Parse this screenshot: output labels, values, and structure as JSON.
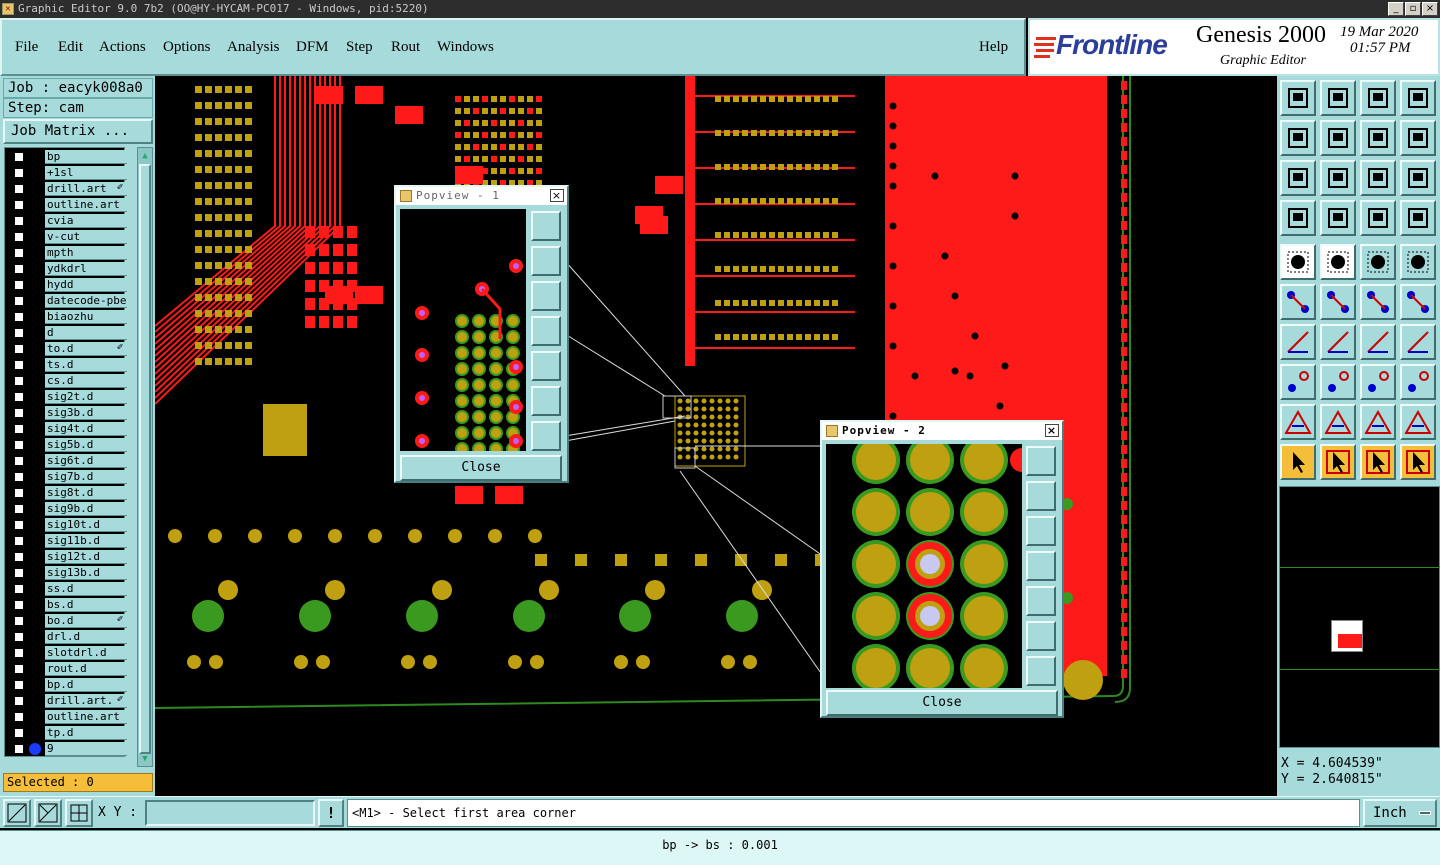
{
  "window": {
    "title": "Graphic Editor 9.0 7b2 (OO@HY-HYCAM-PC017 - Windows, pid:5220)",
    "minimize": "_",
    "maximize": "▫",
    "close": "×"
  },
  "menu": {
    "items": [
      "File",
      "Edit",
      "Actions",
      "Options",
      "Analysis",
      "DFM",
      "Step",
      "Rout",
      "Windows"
    ],
    "help": "Help"
  },
  "brand": {
    "logo": "Frontline",
    "product": "Genesis 2000",
    "subtitle": "Graphic Editor",
    "date": "19 Mar 2020",
    "time": "01:57 PM"
  },
  "left_panel": {
    "job": "Job : eacyk008a0",
    "step": "Step: cam",
    "job_matrix_button": "Job Matrix ...",
    "layers": [
      {
        "name": "bp",
        "mark": ""
      },
      {
        "name": "+1sl",
        "mark": ""
      },
      {
        "name": "drill.art",
        "mark": "✐"
      },
      {
        "name": "outline.art",
        "mark": ""
      },
      {
        "name": "cvia",
        "mark": ""
      },
      {
        "name": "v-cut",
        "mark": ""
      },
      {
        "name": "mpth",
        "mark": ""
      },
      {
        "name": "ydkdrl",
        "mark": ""
      },
      {
        "name": "hydd",
        "mark": ""
      },
      {
        "name": "datecode-pbe",
        "mark": ""
      },
      {
        "name": "biaozhu",
        "mark": ""
      },
      {
        "name": "d",
        "mark": ""
      },
      {
        "name": "to.d",
        "mark": "✐"
      },
      {
        "name": "ts.d",
        "mark": ""
      },
      {
        "name": "cs.d",
        "mark": ""
      },
      {
        "name": "sig2t.d",
        "mark": ""
      },
      {
        "name": "sig3b.d",
        "mark": ""
      },
      {
        "name": "sig4t.d",
        "mark": ""
      },
      {
        "name": "sig5b.d",
        "mark": ""
      },
      {
        "name": "sig6t.d",
        "mark": ""
      },
      {
        "name": "sig7b.d",
        "mark": ""
      },
      {
        "name": "sig8t.d",
        "mark": ""
      },
      {
        "name": "sig9b.d",
        "mark": ""
      },
      {
        "name": "sig10t.d",
        "mark": ""
      },
      {
        "name": "sig11b.d",
        "mark": ""
      },
      {
        "name": "sig12t.d",
        "mark": ""
      },
      {
        "name": "sig13b.d",
        "mark": ""
      },
      {
        "name": "ss.d",
        "mark": ""
      },
      {
        "name": "bs.d",
        "mark": ""
      },
      {
        "name": "bo.d",
        "mark": "✐"
      },
      {
        "name": "drl.d",
        "mark": ""
      },
      {
        "name": "slotdrl.d",
        "mark": ""
      },
      {
        "name": "rout.d",
        "mark": ""
      },
      {
        "name": "bp.d",
        "mark": ""
      },
      {
        "name": "drill.art.",
        "mark": "✐"
      },
      {
        "name": "outline.art",
        "mark": ""
      },
      {
        "name": "tp.d",
        "mark": ""
      },
      {
        "name": "9",
        "mark": ""
      }
    ],
    "selected": "Selected : 0"
  },
  "popview1": {
    "title": "Popview - 1",
    "close": "Close"
  },
  "popview2": {
    "title": "Popview - 2",
    "close": "Close"
  },
  "coords": {
    "x": "X = 4.604539\"",
    "y": "Y = 2.640815\""
  },
  "bottom": {
    "xy_label": "X Y :",
    "xy_value": "",
    "prompt": "<M1> - Select first area corner",
    "units": "Inch",
    "status": "bp -> bs : 0.001"
  },
  "colors": {
    "panel": "#a6dadb",
    "copper_red": "#ff1a1a",
    "pad_gold": "#bfa010",
    "pad_green": "#3a9a20",
    "highlight": "#f5be3a"
  }
}
